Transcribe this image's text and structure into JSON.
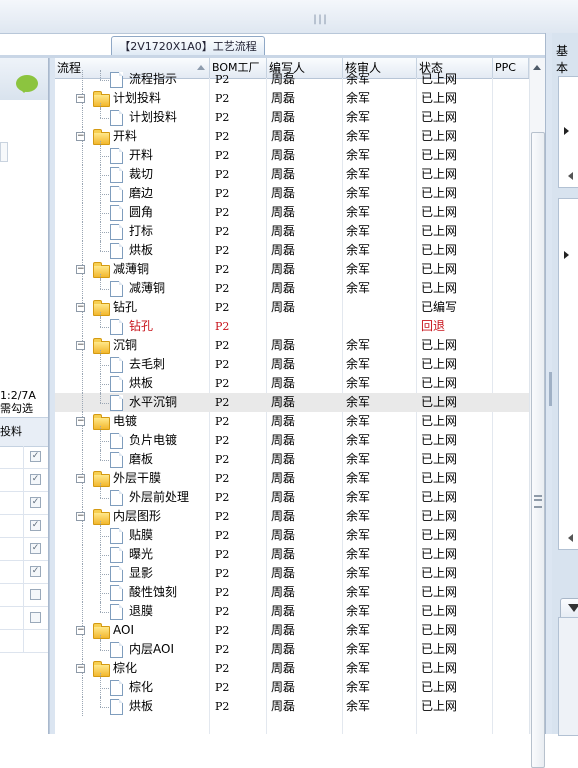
{
  "tab": {
    "label": "【2V1720X1A0】工艺流程"
  },
  "left_panel": {
    "info_line1": "1:2/7A",
    "info_line2": "需勾选",
    "col_header": "投料"
  },
  "right_panel": {
    "title": "基本"
  },
  "grid": {
    "columns": [
      "流程",
      "BOM工厂",
      "编写人",
      "核审人",
      "状态",
      "PPC"
    ],
    "rows": [
      {
        "level": 1,
        "name": "流程指示",
        "bom": "P2",
        "writer": "周磊",
        "reviewer": "余军",
        "status": "已上网"
      },
      {
        "level": 0,
        "name": "计划投料",
        "bom": "P2",
        "writer": "周磊",
        "reviewer": "余军",
        "status": "已上网"
      },
      {
        "level": 1,
        "name": "计划投料",
        "bom": "P2",
        "writer": "周磊",
        "reviewer": "余军",
        "status": "已上网"
      },
      {
        "level": 0,
        "name": "开料",
        "bom": "P2",
        "writer": "周磊",
        "reviewer": "余军",
        "status": "已上网"
      },
      {
        "level": 1,
        "name": "开料",
        "bom": "P2",
        "writer": "周磊",
        "reviewer": "余军",
        "status": "已上网"
      },
      {
        "level": 1,
        "name": "裁切",
        "bom": "P2",
        "writer": "周磊",
        "reviewer": "余军",
        "status": "已上网"
      },
      {
        "level": 1,
        "name": "磨边",
        "bom": "P2",
        "writer": "周磊",
        "reviewer": "余军",
        "status": "已上网"
      },
      {
        "level": 1,
        "name": "圆角",
        "bom": "P2",
        "writer": "周磊",
        "reviewer": "余军",
        "status": "已上网"
      },
      {
        "level": 1,
        "name": "打标",
        "bom": "P2",
        "writer": "周磊",
        "reviewer": "余军",
        "status": "已上网"
      },
      {
        "level": 1,
        "name": "烘板",
        "bom": "P2",
        "writer": "周磊",
        "reviewer": "余军",
        "status": "已上网"
      },
      {
        "level": 0,
        "name": "减薄铜",
        "bom": "P2",
        "writer": "周磊",
        "reviewer": "余军",
        "status": "已上网"
      },
      {
        "level": 1,
        "name": "减薄铜",
        "bom": "P2",
        "writer": "周磊",
        "reviewer": "余军",
        "status": "已上网"
      },
      {
        "level": 0,
        "name": "钻孔",
        "bom": "P2",
        "writer": "周磊",
        "reviewer": "",
        "status": "已编写"
      },
      {
        "level": 1,
        "name": "钻孔",
        "bom": "P2",
        "writer": "",
        "reviewer": "",
        "status": "回退",
        "red": true
      },
      {
        "level": 0,
        "name": "沉铜",
        "bom": "P2",
        "writer": "周磊",
        "reviewer": "余军",
        "status": "已上网"
      },
      {
        "level": 1,
        "name": "去毛刺",
        "bom": "P2",
        "writer": "周磊",
        "reviewer": "余军",
        "status": "已上网"
      },
      {
        "level": 1,
        "name": "烘板",
        "bom": "P2",
        "writer": "周磊",
        "reviewer": "余军",
        "status": "已上网"
      },
      {
        "level": 1,
        "name": "水平沉铜",
        "bom": "P2",
        "writer": "周磊",
        "reviewer": "余军",
        "status": "已上网",
        "selected": true
      },
      {
        "level": 0,
        "name": "电镀",
        "bom": "P2",
        "writer": "周磊",
        "reviewer": "余军",
        "status": "已上网"
      },
      {
        "level": 1,
        "name": "负片电镀",
        "bom": "P2",
        "writer": "周磊",
        "reviewer": "余军",
        "status": "已上网"
      },
      {
        "level": 1,
        "name": "磨板",
        "bom": "P2",
        "writer": "周磊",
        "reviewer": "余军",
        "status": "已上网"
      },
      {
        "level": 0,
        "name": "外层干膜",
        "bom": "P2",
        "writer": "周磊",
        "reviewer": "余军",
        "status": "已上网"
      },
      {
        "level": 1,
        "name": "外层前处理",
        "bom": "P2",
        "writer": "周磊",
        "reviewer": "余军",
        "status": "已上网"
      },
      {
        "level": 0,
        "name": "内层图形",
        "bom": "P2",
        "writer": "周磊",
        "reviewer": "余军",
        "status": "已上网"
      },
      {
        "level": 1,
        "name": "贴膜",
        "bom": "P2",
        "writer": "周磊",
        "reviewer": "余军",
        "status": "已上网"
      },
      {
        "level": 1,
        "name": "曝光",
        "bom": "P2",
        "writer": "周磊",
        "reviewer": "余军",
        "status": "已上网"
      },
      {
        "level": 1,
        "name": "显影",
        "bom": "P2",
        "writer": "周磊",
        "reviewer": "余军",
        "status": "已上网"
      },
      {
        "level": 1,
        "name": "酸性蚀刻",
        "bom": "P2",
        "writer": "周磊",
        "reviewer": "余军",
        "status": "已上网"
      },
      {
        "level": 1,
        "name": "退膜",
        "bom": "P2",
        "writer": "周磊",
        "reviewer": "余军",
        "status": "已上网"
      },
      {
        "level": 0,
        "name": "AOI",
        "bom": "P2",
        "writer": "周磊",
        "reviewer": "余军",
        "status": "已上网"
      },
      {
        "level": 1,
        "name": "内层AOI",
        "bom": "P2",
        "writer": "周磊",
        "reviewer": "余军",
        "status": "已上网"
      },
      {
        "level": 0,
        "name": "棕化",
        "bom": "P2",
        "writer": "周磊",
        "reviewer": "余军",
        "status": "已上网"
      },
      {
        "level": 1,
        "name": "棕化",
        "bom": "P2",
        "writer": "周磊",
        "reviewer": "余军",
        "status": "已上网"
      },
      {
        "level": 1,
        "name": "烘板",
        "bom": "P2",
        "writer": "周磊",
        "reviewer": "余军",
        "status": "已上网"
      }
    ]
  }
}
